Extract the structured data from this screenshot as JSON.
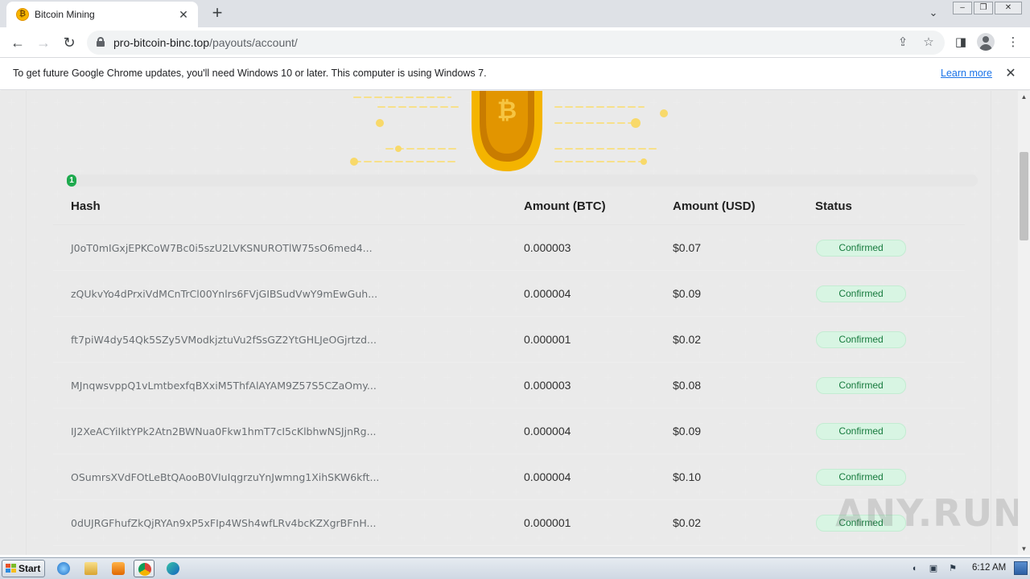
{
  "browser": {
    "tab_title": "Bitcoin Mining",
    "tab_favicon": "bitcoin-icon",
    "url_host": "pro-bitcoin-binc.top",
    "url_path": "/payouts/account/",
    "infobar_message": "To get future Google Chrome updates, you'll need Windows 10 or later. This computer is using Windows 7.",
    "infobar_link": "Learn more"
  },
  "progress": {
    "label": "1",
    "fraction": 0.01,
    "color": "#1eaa4e"
  },
  "table": {
    "headers": [
      "Hash",
      "Amount (BTC)",
      "Amount (USD)",
      "Status"
    ],
    "rows": [
      {
        "hash": "J0oT0mIGxjEPKCoW7Bc0i5szU2LVKSNUROTlW75sO6med4...",
        "btc": "0.000003",
        "usd": "$0.07",
        "status": "Confirmed"
      },
      {
        "hash": "zQUkvYo4dPrxiVdMCnTrCl00Ynlrs6FVjGIBSudVwY9mEwGuh...",
        "btc": "0.000004",
        "usd": "$0.09",
        "status": "Confirmed"
      },
      {
        "hash": "ft7piW4dy54Qk5SZy5VModkjztuVu2fSsGZ2YtGHLJeOGjrtzd...",
        "btc": "0.000001",
        "usd": "$0.02",
        "status": "Confirmed"
      },
      {
        "hash": "MJnqwsvppQ1vLmtbexfqBXxiM5ThfAlAYAM9Z57S5CZaOmy...",
        "btc": "0.000003",
        "usd": "$0.08",
        "status": "Confirmed"
      },
      {
        "hash": "IJ2XeACYiIktYPk2Atn2BWNua0Fkw1hmT7cI5cKlbhwNSJjnRg...",
        "btc": "0.000004",
        "usd": "$0.09",
        "status": "Confirmed"
      },
      {
        "hash": "OSumrsXVdFOtLeBtQAooB0VIuIqgrzuYnJwmng1XihSKW6kft...",
        "btc": "0.000004",
        "usd": "$0.10",
        "status": "Confirmed"
      },
      {
        "hash": "0dUJRGFhufZkQjRYAn9xP5xFIp4WSh4wfLRv4bcKZXgrBFnH...",
        "btc": "0.000001",
        "usd": "$0.02",
        "status": "Confirmed"
      }
    ]
  },
  "watermark": "ANY.RUN",
  "taskbar": {
    "start_label": "Start",
    "clock": "6:12 AM",
    "apps": [
      "ie-icon",
      "explorer-icon",
      "media-player-icon",
      "chrome-icon",
      "edge-icon"
    ]
  },
  "colors": {
    "status_bg": "#d8f5e3",
    "status_text": "#167a3d",
    "coin": "#f7b500"
  }
}
